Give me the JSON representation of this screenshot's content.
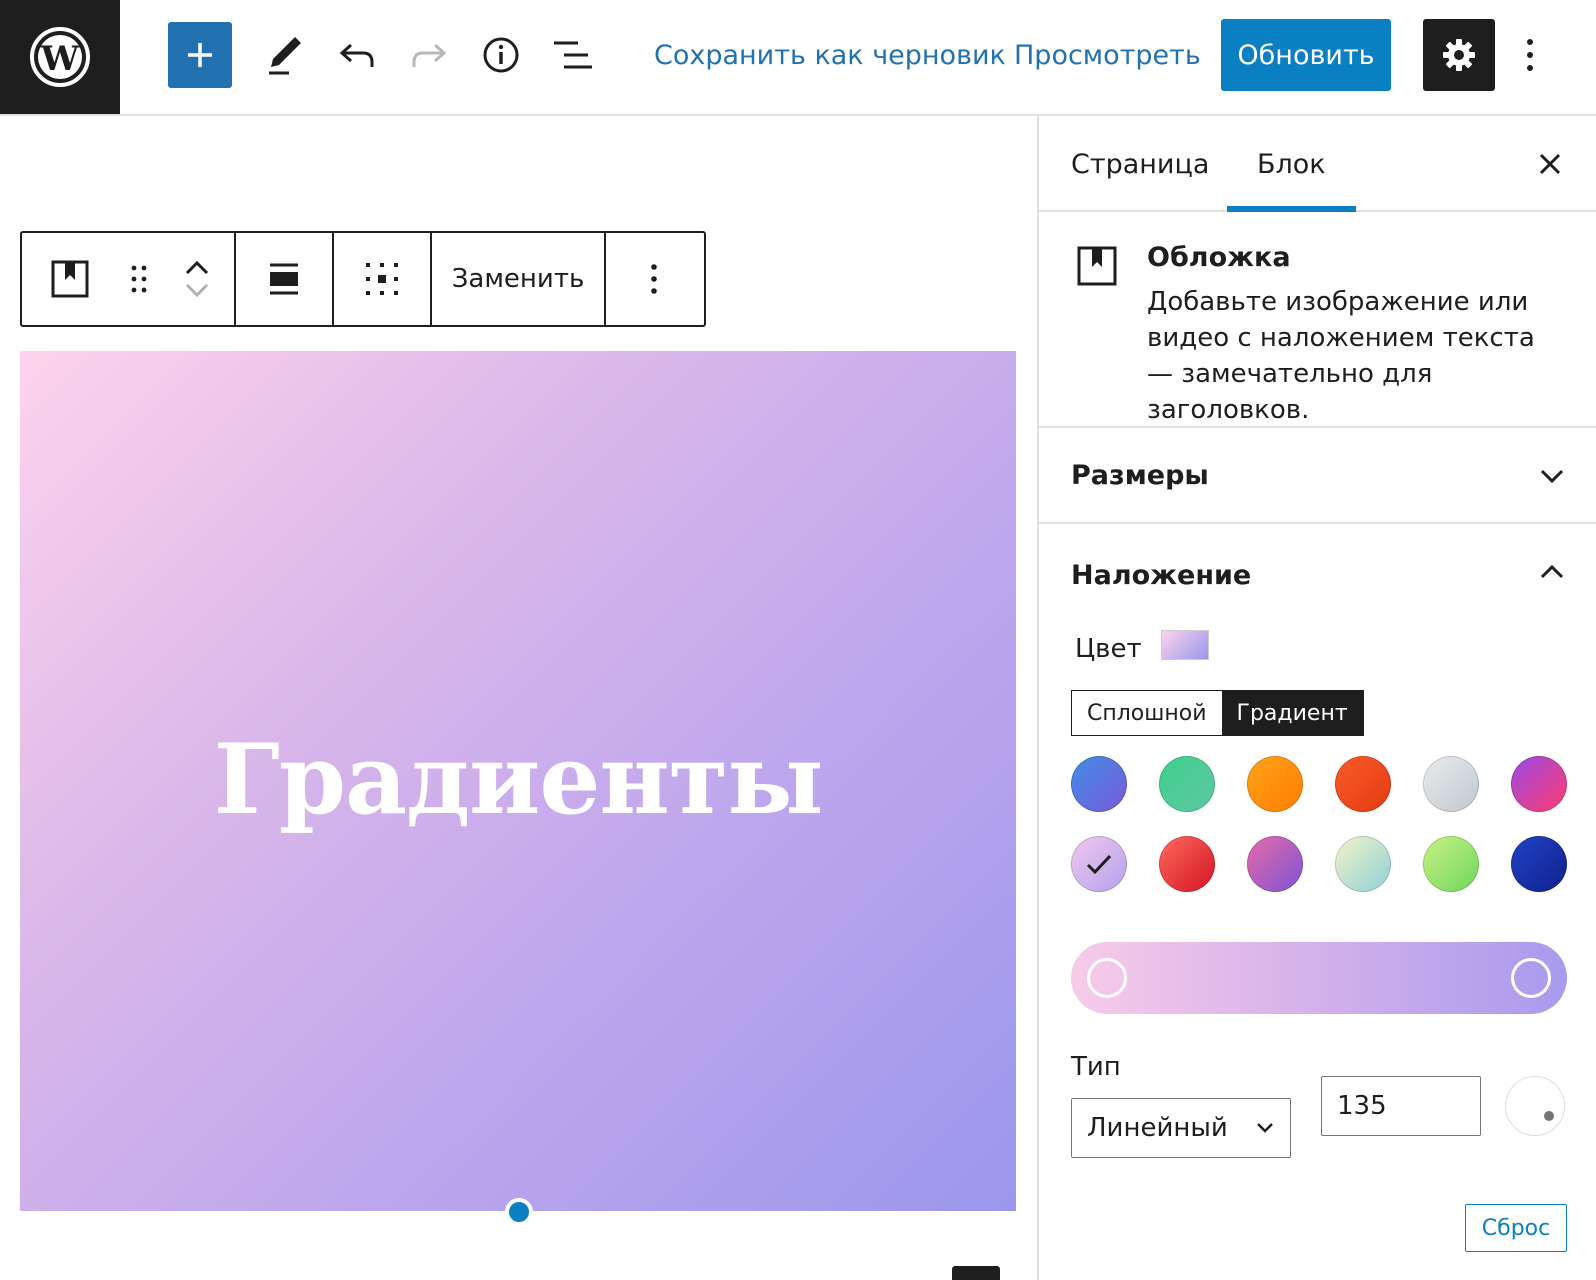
{
  "topbar": {
    "save_draft": "Сохранить как черновик",
    "preview": "Просмотреть",
    "update": "Обновить",
    "icons": [
      "wordpress-logo",
      "plus-icon",
      "pencil-icon",
      "undo-icon",
      "redo-icon",
      "info-icon",
      "list-view-icon",
      "gear-icon",
      "more-vertical-icon"
    ]
  },
  "block_toolbar": {
    "replace_label": "Заменить",
    "icons": [
      "cover-block-icon",
      "drag-handle-icon",
      "move-up-icon",
      "move-down-icon",
      "align-full-icon",
      "content-position-icon",
      "more-vertical-icon"
    ]
  },
  "cover": {
    "heading": "Градиенты",
    "gradient": [
      "#fdd3ec",
      "#9b97ec"
    ]
  },
  "sidebar": {
    "tabs": [
      "Страница",
      "Блок"
    ],
    "active_tab": "Блок",
    "block": {
      "title": "Обложка",
      "description": "Добавьте изображение или видео с наложением текста — замечательно для заголовков."
    },
    "panels": {
      "dimensions": "Размеры",
      "overlay": "Наложение"
    },
    "overlay": {
      "color_label": "Цвет",
      "mode_solid": "Сплошной",
      "mode_gradient": "Градиент",
      "active_mode": "Градиент",
      "type_label": "Тип",
      "type_value": "Линейный",
      "angle_value": "135",
      "reset_label": "Сброс",
      "selected_swatch_index": 6,
      "swatches": [
        [
          "#3f8de6",
          "#7a5ad8"
        ],
        [
          "#3fd08e",
          "#5fc7a0"
        ],
        [
          "#ffa21a",
          "#ff7e00"
        ],
        [
          "#f95c2b",
          "#e33a12"
        ],
        [
          "#e8ecef",
          "#c2c7cc"
        ],
        [
          "#9a4be8",
          "#ff3b6b"
        ],
        [
          "#f1c7ec",
          "#b3a3ee"
        ],
        [
          "#ff6b5a",
          "#d31225"
        ],
        [
          "#e86aa9",
          "#7c54d4"
        ],
        [
          "#f3f3c9",
          "#8ed0d6"
        ],
        [
          "#c8f184",
          "#6fd65e"
        ],
        [
          "#1f44c5",
          "#12208e"
        ]
      ]
    }
  }
}
